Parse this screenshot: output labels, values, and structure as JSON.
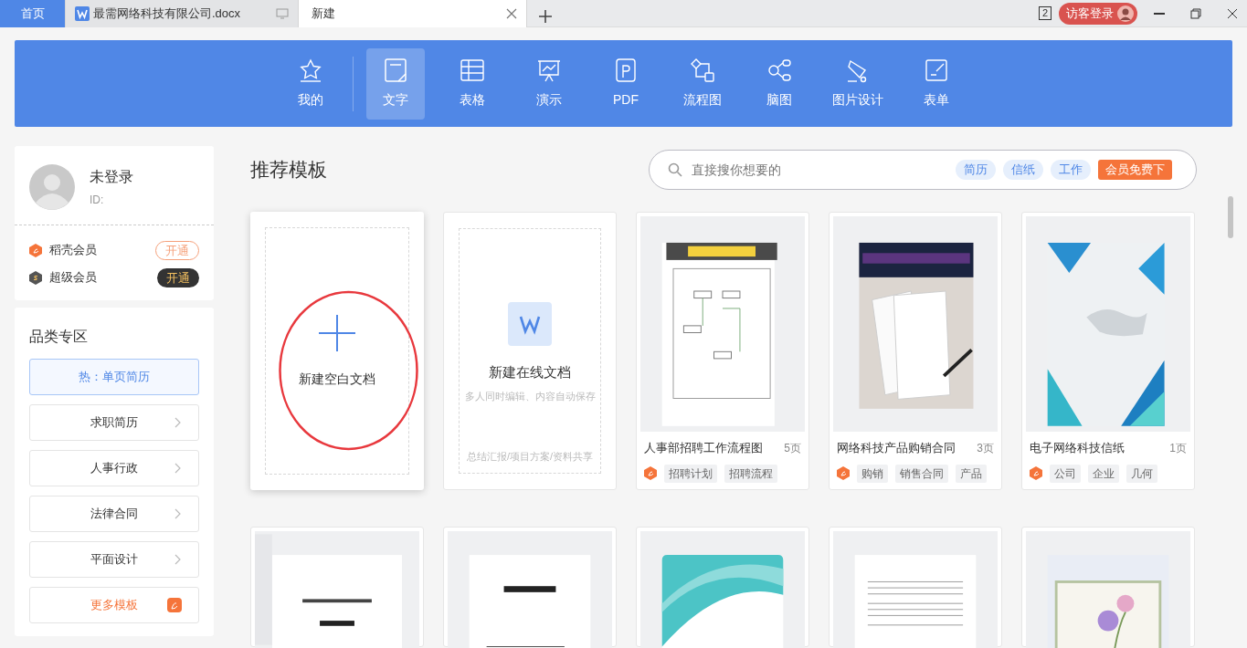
{
  "tabs": [
    {
      "label": "首页",
      "kind": "home",
      "selected": false
    },
    {
      "label": "最需网络科技有限公司.docx",
      "kind": "document",
      "selected": false
    },
    {
      "label": "新建",
      "kind": "new",
      "selected": true
    }
  ],
  "title_bar": {
    "window_count": "2",
    "login": "访客登录"
  },
  "categories": [
    {
      "label": "我的",
      "kind": "star",
      "selected": false
    },
    {
      "label": "文字",
      "kind": "doc",
      "selected": true
    },
    {
      "label": "表格",
      "kind": "table",
      "selected": false
    },
    {
      "label": "演示",
      "kind": "slides",
      "selected": false
    },
    {
      "label": "PDF",
      "kind": "pdf",
      "selected": false
    },
    {
      "label": "流程图",
      "kind": "flow",
      "selected": false
    },
    {
      "label": "脑图",
      "kind": "mind",
      "selected": false
    },
    {
      "label": "图片设计",
      "kind": "design",
      "selected": false
    },
    {
      "label": "表单",
      "kind": "form",
      "selected": false
    }
  ],
  "user": {
    "name": "未登录",
    "id_label": "ID:"
  },
  "memberships": [
    {
      "label": "稻壳会员",
      "action": "开通",
      "kind": "docer"
    },
    {
      "label": "超级会员",
      "action": "开通",
      "kind": "super"
    }
  ],
  "category_zone": {
    "title": "品类专区",
    "items": [
      {
        "label": "热：单页简历",
        "kind": "hot"
      },
      {
        "label": "求职简历",
        "kind": "link"
      },
      {
        "label": "人事行政",
        "kind": "link"
      },
      {
        "label": "法律合同",
        "kind": "link"
      },
      {
        "label": "平面设计",
        "kind": "link"
      },
      {
        "label": "更多模板",
        "kind": "more"
      }
    ]
  },
  "section_title": "推荐模板",
  "search": {
    "placeholder": "直接搜你想要的",
    "tags": [
      "简历",
      "信纸",
      "工作"
    ],
    "promo": "会员免费下"
  },
  "new_cards": [
    {
      "kind": "blank",
      "title": "新建空白文档",
      "circled": true
    },
    {
      "kind": "online",
      "title": "新建在线文档",
      "subtitle": "多人同时编辑、内容自动保存",
      "footer": "总结汇报/项目方案/资料共享"
    }
  ],
  "templates": [
    {
      "kind": "picture",
      "title": "人事部招聘工作流程图",
      "pages": "5页",
      "tags": [
        "招聘计划",
        "招聘流程"
      ]
    },
    {
      "kind": "picture",
      "title": "网络科技产品购销合同",
      "pages": "3页",
      "tags": [
        "购销",
        "销售合同",
        "产品"
      ]
    },
    {
      "kind": "picture",
      "title": "电子网络科技信纸",
      "pages": "1页",
      "tags": [
        "公司",
        "企业",
        "几何"
      ]
    }
  ]
}
